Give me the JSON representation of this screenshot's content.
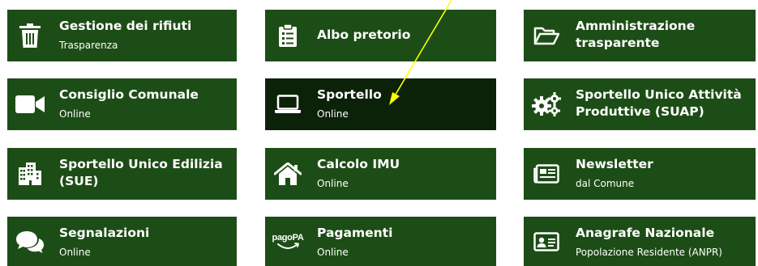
{
  "tiles": [
    {
      "title": "Gestione dei rifiuti",
      "subtitle": "Trasparenza"
    },
    {
      "title": "Albo pretorio"
    },
    {
      "title_line1": "Amministrazione",
      "title_line2": "trasparente"
    },
    {
      "title": "Consiglio Comunale",
      "subtitle": "Online"
    },
    {
      "title": "Sportello",
      "subtitle": "Online"
    },
    {
      "title_line1": "Sportello Unico Attività",
      "title_line2": "Produttive (SUAP)"
    },
    {
      "title_line1": "Sportello Unico Edilizia",
      "title_line2": "(SUE)"
    },
    {
      "title": "Calcolo IMU",
      "subtitle": "Online"
    },
    {
      "title": "Newsletter",
      "subtitle": "dal Comune"
    },
    {
      "title": "Segnalazioni",
      "subtitle": "Online"
    },
    {
      "title": "Pagamenti",
      "subtitle": "Online",
      "logo_text": "pagoPA"
    },
    {
      "title": "Anagrafe Nazionale",
      "subtitle": "Popolazione Residente (ANPR)"
    }
  ],
  "colors": {
    "tile": "#1d4d16",
    "tile_active": "#0b2208",
    "text": "#ffffff",
    "annotation_arrow": "#ffff00"
  },
  "icons": [
    "trash-icon",
    "clipboard-icon",
    "folder-open-icon",
    "video-camera-icon",
    "laptop-icon",
    "gears-icon",
    "building-icon",
    "home-icon",
    "newspaper-icon",
    "comments-icon",
    "pagopa-logo",
    "id-card-icon"
  ]
}
